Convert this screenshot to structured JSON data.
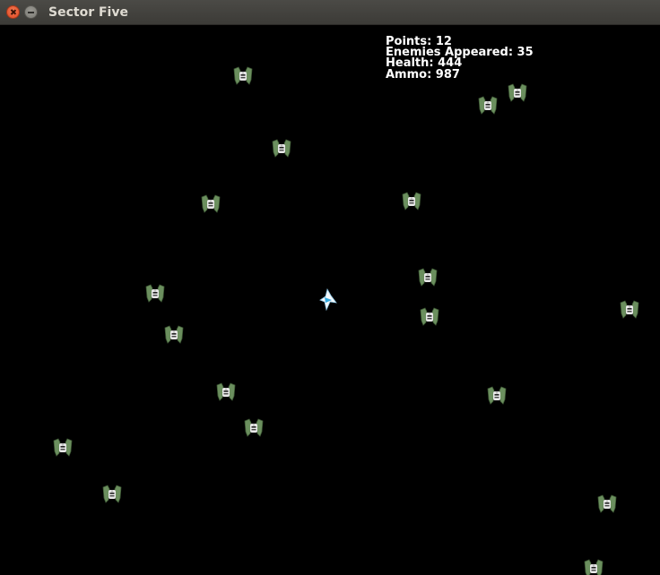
{
  "window": {
    "title": "Sector Five",
    "close_icon": "close-icon",
    "minimize_icon": "minimize-icon"
  },
  "hud": {
    "points_label": "Points: 12",
    "enemies_label": "Enemies Appeared: 35",
    "health_label": "Health: 444",
    "ammo_label": "Ammo: 987"
  },
  "sprites": {
    "enemy_icon": "enemy-ship-icon",
    "player_icon": "player-ship-icon",
    "enemy_color": "#6b8f5e",
    "player_color": "#2fa8e0"
  }
}
